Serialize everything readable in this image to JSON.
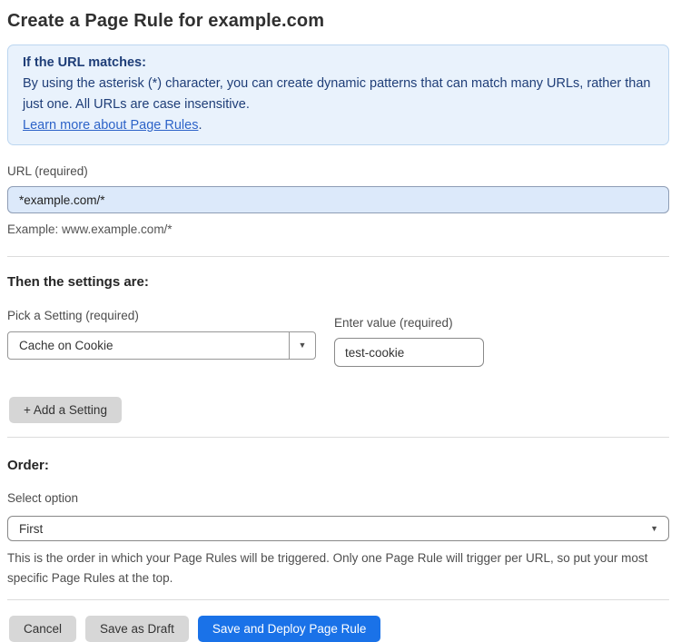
{
  "page": {
    "title": "Create a Page Rule for example.com"
  },
  "info_box": {
    "heading": "If the URL matches:",
    "body": "By using the asterisk (*) character, you can create dynamic patterns that can match many URLs, rather than just one. All URLs are case insensitive.",
    "link_label": "Learn more about Page Rules",
    "link_suffix": "."
  },
  "url_field": {
    "label": "URL (required)",
    "value": "*example.com/*",
    "helper": "Example: www.example.com/*"
  },
  "settings_section": {
    "heading": "Then the settings are:",
    "setting_label": "Pick a Setting (required)",
    "setting_selected": "Cache on Cookie",
    "value_label": "Enter value (required)",
    "value_text": "test-cookie",
    "add_button_label": "+ Add a Setting"
  },
  "order_section": {
    "heading": "Order:",
    "select_label": "Select option",
    "selected_option": "First",
    "helper": "This is the order in which your Page Rules will be triggered. Only one Page Rule will trigger per URL, so put your most specific Page Rules at the top."
  },
  "footer": {
    "cancel_label": "Cancel",
    "save_draft_label": "Save as Draft",
    "save_deploy_label": "Save and Deploy Page Rule"
  },
  "icons": {
    "caret_down": "▼"
  },
  "colors": {
    "info_box_bg": "#e9f2fc",
    "info_box_border": "#bcd6f0",
    "info_text_navy": "#1f3e78",
    "link_blue": "#2d63c8",
    "url_input_bg": "#dce9fa",
    "primary_button_blue": "#1a72e8",
    "secondary_button_gray": "#d7d7d7"
  }
}
